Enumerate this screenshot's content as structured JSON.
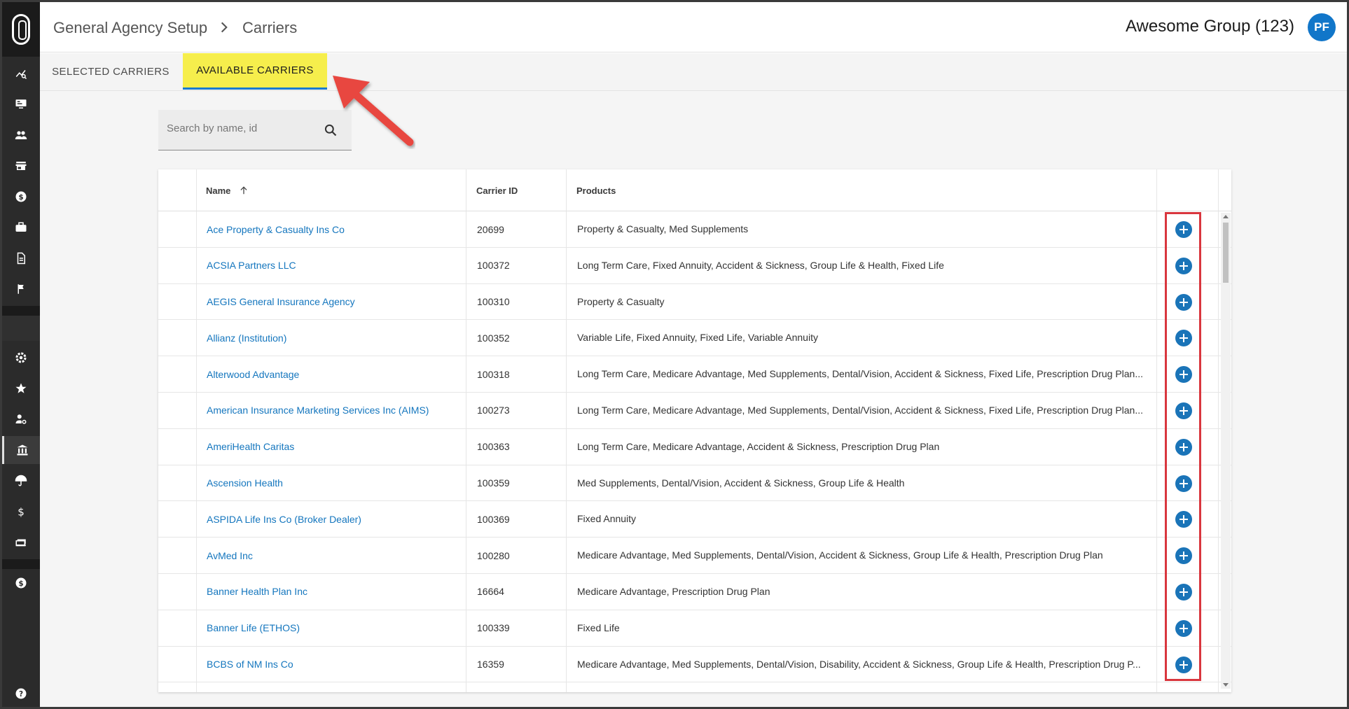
{
  "header": {
    "breadcrumb": [
      "General Agency Setup",
      "Carriers"
    ],
    "group_name": "Awesome Group (123)",
    "avatar_initials": "PF"
  },
  "tabs": [
    {
      "label": "SELECTED CARRIERS",
      "active": false
    },
    {
      "label": "AVAILABLE CARRIERS",
      "active": true
    }
  ],
  "search": {
    "placeholder": "Search by name, id"
  },
  "table": {
    "columns": [
      "Name",
      "Carrier ID",
      "Products"
    ],
    "rows": [
      {
        "name": "Ace Property & Casualty Ins Co",
        "id": "20699",
        "products": "Property & Casualty, Med Supplements"
      },
      {
        "name": "ACSIA Partners LLC",
        "id": "100372",
        "products": "Long Term Care, Fixed Annuity, Accident & Sickness, Group Life & Health, Fixed Life"
      },
      {
        "name": "AEGIS General Insurance Agency",
        "id": "100310",
        "products": "Property & Casualty"
      },
      {
        "name": "Allianz (Institution)",
        "id": "100352",
        "products": "Variable Life, Fixed Annuity, Fixed Life, Variable Annuity"
      },
      {
        "name": "Alterwood Advantage",
        "id": "100318",
        "products": "Long Term Care, Medicare Advantage, Med Supplements, Dental/Vision, Accident & Sickness, Fixed Life, Prescription Drug Plan..."
      },
      {
        "name": "American Insurance Marketing Services Inc (AIMS)",
        "id": "100273",
        "products": "Long Term Care, Medicare Advantage, Med Supplements, Dental/Vision, Accident & Sickness, Fixed Life, Prescription Drug Plan..."
      },
      {
        "name": "AmeriHealth Caritas",
        "id": "100363",
        "products": "Long Term Care, Medicare Advantage, Accident & Sickness, Prescription Drug Plan"
      },
      {
        "name": "Ascension Health",
        "id": "100359",
        "products": "Med Supplements, Dental/Vision, Accident & Sickness, Group Life & Health"
      },
      {
        "name": "ASPIDA Life Ins Co (Broker Dealer)",
        "id": "100369",
        "products": "Fixed Annuity"
      },
      {
        "name": "AvMed Inc",
        "id": "100280",
        "products": "Medicare Advantage, Med Supplements, Dental/Vision, Accident & Sickness, Group Life & Health, Prescription Drug Plan"
      },
      {
        "name": "Banner Health Plan Inc",
        "id": "16664",
        "products": "Medicare Advantage, Prescription Drug Plan"
      },
      {
        "name": "Banner Life (ETHOS)",
        "id": "100339",
        "products": "Fixed Life"
      },
      {
        "name": "BCBS of NM Ins Co",
        "id": "16359",
        "products": "Medicare Advantage, Med Supplements, Dental/Vision, Disability, Accident & Sickness, Group Life & Health, Prescription Drug P..."
      }
    ]
  },
  "sidebar": {
    "icons": [
      "analytics-icon",
      "monitor-icon",
      "people-icon",
      "store-icon",
      "money-circle-icon",
      "briefcase-icon",
      "document-icon",
      "flag-icon",
      "gear-icon",
      "star-badge-icon",
      "user-settings-icon",
      "bank-icon",
      "umbrella-icon",
      "dollar-icon",
      "payments-icon",
      "money-circle-icon-2",
      "help-icon"
    ]
  },
  "colors": {
    "accent": "#1a74b8",
    "tab_highlight": "#f6ee4c",
    "annotation": "#d9363e"
  }
}
